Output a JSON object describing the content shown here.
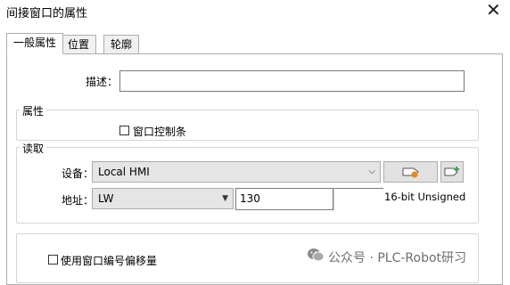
{
  "window": {
    "title": "间接窗口的属性",
    "close_symbol": "✕"
  },
  "tabs": [
    {
      "label": "一般属性",
      "active": true
    },
    {
      "label": "位置",
      "active": false
    },
    {
      "label": "轮廓",
      "active": false
    }
  ],
  "general": {
    "description_label": "描述：",
    "description_value": ""
  },
  "properties_group": {
    "title": "属性",
    "window_control_bar_label": "窗口控制条",
    "window_control_bar_checked": false
  },
  "read_group": {
    "title": "读取",
    "device_label": "设备：",
    "device_value": "Local HMI",
    "address_label": "地址：",
    "address_type": "LW",
    "address_value": "130",
    "data_format": "16-bit Unsigned",
    "device_settings_icon": "tag-settings-icon",
    "device_add_icon": "tag-add-icon"
  },
  "offset_group": {
    "use_offset_label": "使用窗口编号偏移量",
    "use_offset_checked": false
  },
  "watermark": {
    "text": "公众号 · PLC-Robot研习"
  },
  "colors": {
    "accent_orange": "#e88a1c",
    "accent_green": "#3aa34a"
  }
}
